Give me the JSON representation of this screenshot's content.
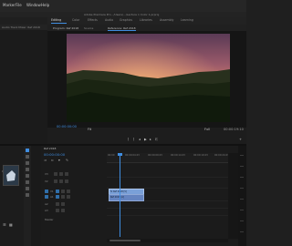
{
  "menubar": {
    "items": [
      "Marker",
      "File",
      "Window",
      "Help"
    ]
  },
  "window_title": "Adobe Premiere Pro - /Users/.../Lecture 1 Color 1.prproj",
  "tabs": [
    {
      "label": "Editing",
      "active": true
    },
    {
      "label": "Color",
      "active": false
    },
    {
      "label": "Effects",
      "active": false
    },
    {
      "label": "Audio",
      "active": false
    },
    {
      "label": "Graphics",
      "active": false
    },
    {
      "label": "Libraries",
      "active": false
    },
    {
      "label": "Assembly",
      "active": false
    },
    {
      "label": "Learning",
      "active": false
    }
  ],
  "left_panel": {
    "tab_label": "Audio Track Mixer: Ref 2018"
  },
  "monitor": {
    "header_tabs": [
      "Program: Ref 2018",
      "Source",
      "Reference: Ref 2018"
    ],
    "timecode": "00:00:00:00",
    "fit_label": "Fit",
    "quality_label": "Full",
    "duration": "00:00:19:10"
  },
  "media_panel": {
    "label": "Ref 2018"
  },
  "timeline": {
    "tab_label": "Ref 2018",
    "timecode": "00:00:00:00",
    "ruler_labels": [
      "00:00",
      "00:00:04:23",
      "00:00:09:23",
      "00:00:14:23",
      "00:00:19:23",
      "00:00:24:23"
    ],
    "tracks": [
      {
        "name": "V3"
      },
      {
        "name": "V2"
      },
      {
        "name": "V1",
        "target": true
      },
      {
        "name": "A1",
        "target": true
      },
      {
        "name": "A2"
      },
      {
        "name": "A3"
      },
      {
        "name": "Master"
      }
    ],
    "clip_video_label": "fx Ref 2018 [V]",
    "clip_audio_label": "Ref 2018 [A]"
  },
  "colors": {
    "accent": "#3f8de0",
    "clip_video": "#7aa0d8",
    "clip_audio": "#6584c0",
    "sky_top": "#6a3a4e",
    "sky_glow": "#e99a5e",
    "hills": "#16210f"
  },
  "icons": [
    "selection-tool-icon",
    "track-select-icon",
    "ripple-edit-icon",
    "razor-tool-icon",
    "slip-tool-icon",
    "pen-tool-icon",
    "hand-tool-icon",
    "type-tool-icon",
    "play-icon",
    "step-back-icon",
    "step-forward-icon",
    "mark-in-icon",
    "mark-out-icon",
    "export-frame-icon",
    "wrench-icon",
    "settings-icon"
  ]
}
